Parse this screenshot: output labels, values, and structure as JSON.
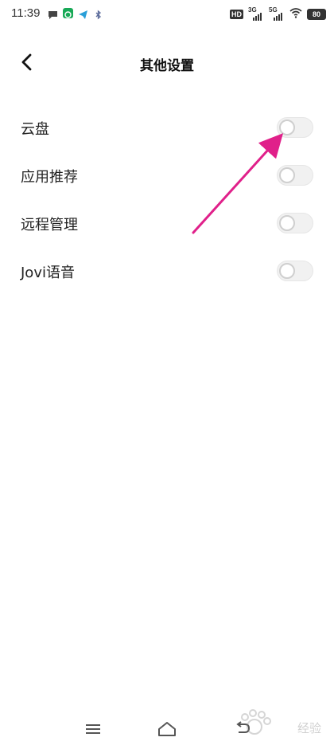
{
  "status_bar": {
    "time": "11:39",
    "left_icons": [
      "chat-bubble-icon",
      "wechat-icon",
      "telegram-icon",
      "bluetooth-icon"
    ],
    "hd_badge": "HD",
    "networks": [
      {
        "label": "3G"
      },
      {
        "label": "5G"
      }
    ],
    "battery_level": "80"
  },
  "header": {
    "title": "其他设置",
    "back_icon": "chevron-left-icon"
  },
  "settings": [
    {
      "label": "云盘",
      "enabled": false
    },
    {
      "label": "应用推荐",
      "enabled": false
    },
    {
      "label": "远程管理",
      "enabled": false
    },
    {
      "label": "Jovi语音",
      "enabled": false
    }
  ],
  "annotation": {
    "color": "#e0208a"
  },
  "nav_bar": {
    "icons": [
      "menu-icon",
      "home-icon",
      "back-nav-icon"
    ]
  },
  "watermark": {
    "text": "经验"
  },
  "colors": {
    "text": "#222222",
    "toggle_off_track": "#f1f1f1",
    "toggle_knob_border": "#cfcfcf",
    "annotation_arrow": "#e0208a"
  }
}
